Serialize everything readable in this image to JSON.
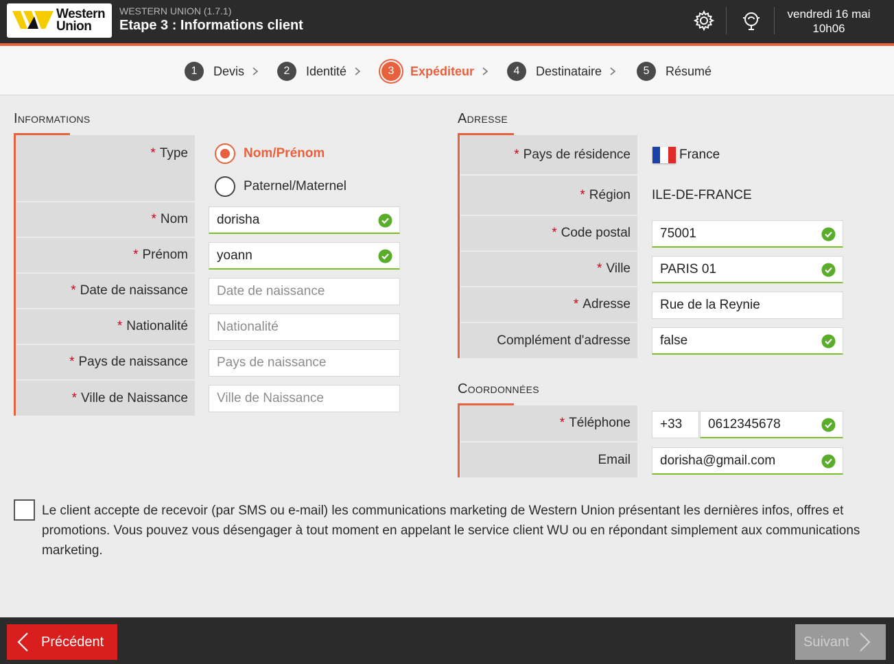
{
  "header": {
    "logo_text_line1": "Western",
    "logo_text_line2": "Union",
    "app_version": "WESTERN UNION (1.7.1)",
    "step_title": "Etape 3 : Informations client",
    "date": "vendredi 16 mai",
    "time": "10h06"
  },
  "colors": {
    "accent": "#e8603c",
    "valid": "#7cbf2a",
    "required": "#d0021b",
    "header_bg": "#2b2b2b",
    "prev_button": "#d91e1e"
  },
  "stepper": [
    {
      "num": "1",
      "label": "Devis"
    },
    {
      "num": "2",
      "label": "Identité"
    },
    {
      "num": "3",
      "label": "Expéditeur",
      "active": true
    },
    {
      "num": "4",
      "label": "Destinataire"
    },
    {
      "num": "5",
      "label": "Résumé"
    }
  ],
  "informations": {
    "title": "Informations",
    "required_mark": "*",
    "type_label": "Type",
    "type_options": [
      "Nom/Prénom",
      "Paternel/Maternel"
    ],
    "nom_label": "Nom",
    "nom_value": "dorisha",
    "prenom_label": "Prénom",
    "prenom_value": "yoann",
    "dob_label": "Date de naissance",
    "dob_placeholder": "Date de naissance",
    "nationalite_label": "Nationalité",
    "nationalite_placeholder": "Nationalité",
    "pays_naissance_label": "Pays de naissance",
    "pays_naissance_placeholder": "Pays de naissance",
    "ville_naissance_label": "Ville de Naissance",
    "ville_naissance_placeholder": "Ville de Naissance"
  },
  "adresse": {
    "title": "Adresse",
    "pays_label": "Pays de résidence",
    "pays_value": "France",
    "region_label": "Région",
    "region_value": "ILE-DE-FRANCE",
    "cp_label": "Code postal",
    "cp_value": "75001",
    "ville_label": "Ville",
    "ville_value": "PARIS 01",
    "adresse_label": "Adresse",
    "adresse_value": "Rue de la Reynie",
    "complement_label": "Complément d'adresse",
    "complement_value": "false"
  },
  "coordonnees": {
    "title": "Coordonnées",
    "tel_label": "Téléphone",
    "tel_prefix": "+33",
    "tel_value": "0612345678",
    "email_label": "Email",
    "email_value": "dorisha@gmail.com"
  },
  "consent": {
    "text": "Le client accepte de recevoir (par SMS ou e-mail) les communications marketing de Western Union présentant les dernières infos, offres et promotions. Vous pouvez vous désengager à tout moment en appelant le service client WU ou en répondant simplement aux communications marketing."
  },
  "footer": {
    "prev_label": "Précédent",
    "next_label": "Suivant"
  }
}
